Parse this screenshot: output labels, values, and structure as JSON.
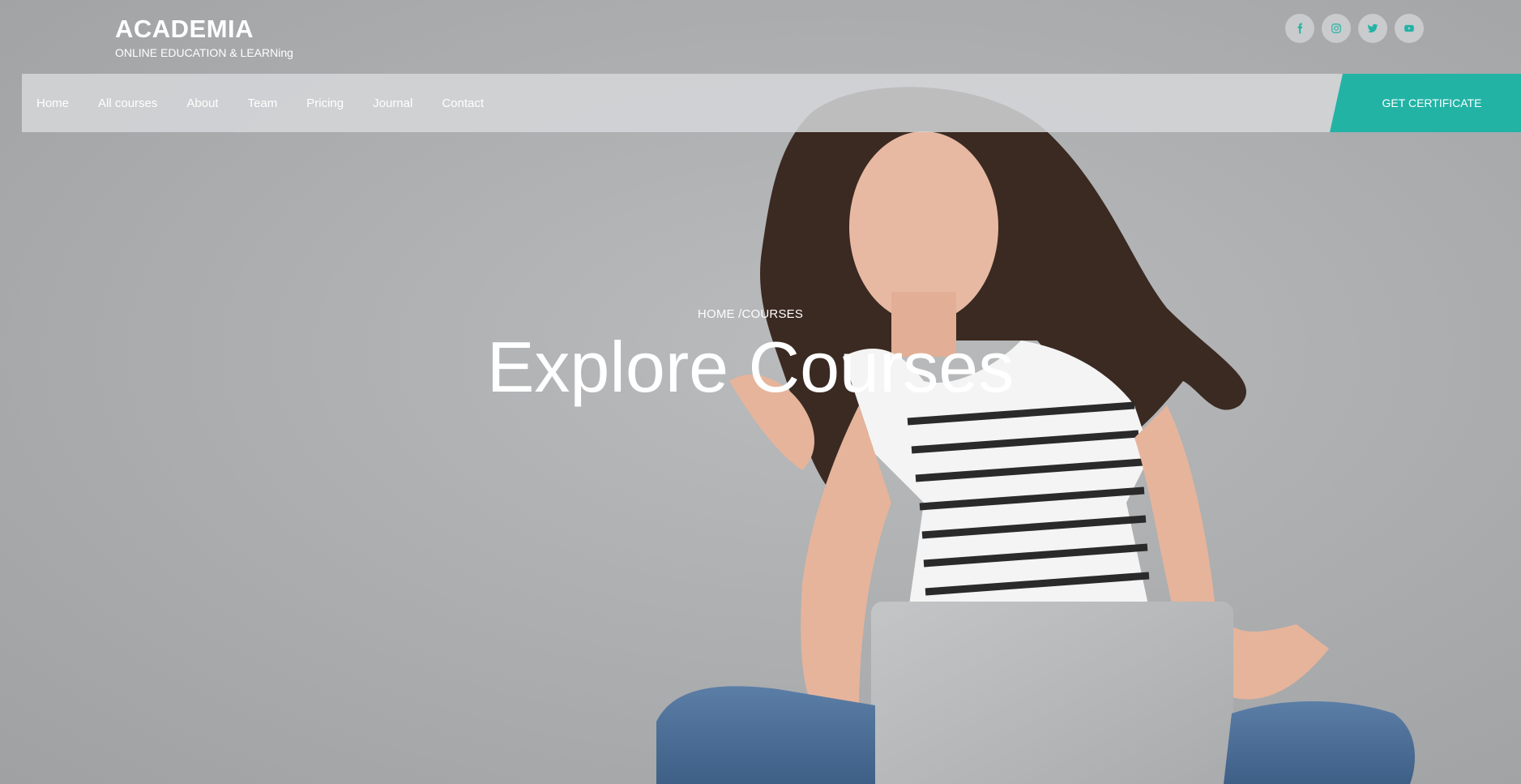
{
  "brand": {
    "title": "ACADEMIA",
    "tagline": "ONLINE EDUCATION & LEARNing"
  },
  "social": [
    {
      "name": "facebook-icon",
      "color": "#22b3a5"
    },
    {
      "name": "instagram-icon",
      "color": "#22b3a5"
    },
    {
      "name": "twitter-icon",
      "color": "#22b3a5"
    },
    {
      "name": "youtube-icon",
      "color": "#22b3a5"
    }
  ],
  "nav": {
    "items": [
      {
        "label": "Home"
      },
      {
        "label": "All courses"
      },
      {
        "label": "About"
      },
      {
        "label": "Team"
      },
      {
        "label": "Pricing"
      },
      {
        "label": "Journal"
      },
      {
        "label": "Contact"
      }
    ],
    "cta_label": "GET CERTIFICATE"
  },
  "hero": {
    "breadcrumb_home": "HOME",
    "breadcrumb_separator": " /",
    "breadcrumb_current": "COURSES",
    "title": "Explore Courses"
  },
  "colors": {
    "accent": "#22b3a5",
    "background": "#a9abad"
  }
}
